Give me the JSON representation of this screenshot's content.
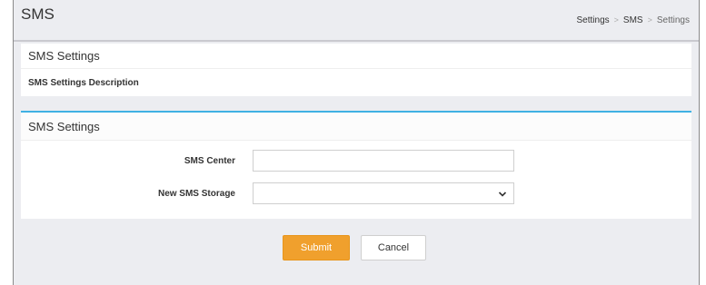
{
  "header": {
    "title": "SMS",
    "breadcrumb": [
      "Settings",
      "SMS",
      "Settings"
    ]
  },
  "info_panel": {
    "title": "SMS Settings",
    "description": "SMS Settings Description"
  },
  "form_panel": {
    "title": "SMS Settings",
    "fields": [
      {
        "label": "SMS Center",
        "value": ""
      },
      {
        "label": "New SMS Storage",
        "selected": ""
      }
    ]
  },
  "actions": {
    "submit_label": "Submit",
    "cancel_label": "Cancel"
  },
  "colors": {
    "accent": "#3fb1e3",
    "submit": "#f0a02d"
  }
}
